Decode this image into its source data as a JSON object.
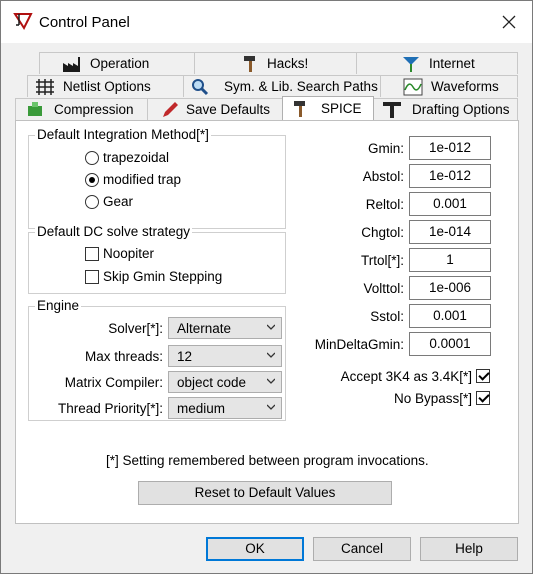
{
  "window": {
    "title": "Control Panel"
  },
  "tabs": {
    "row1": [
      {
        "label": "Operation",
        "icon": "factory-icon"
      },
      {
        "label": "Hacks!",
        "icon": "hammer-icon"
      },
      {
        "label": "Internet",
        "icon": "antenna-icon"
      }
    ],
    "row2": [
      {
        "label": "Netlist Options",
        "icon": "grid-icon"
      },
      {
        "label": "Sym. & Lib. Search Paths",
        "icon": "magnifier-icon"
      },
      {
        "label": "Waveforms",
        "icon": "waveform-icon"
      }
    ],
    "row3": [
      {
        "label": "Compression",
        "icon": "compress-icon"
      },
      {
        "label": "Save Defaults",
        "icon": "pen-icon"
      },
      {
        "label": "SPICE",
        "icon": "hammer-icon",
        "active": true
      },
      {
        "label": "Drafting Options",
        "icon": "t-square-icon"
      }
    ]
  },
  "integration": {
    "title": "Default Integration Method[*]",
    "options": [
      "trapezoidal",
      "modified trap",
      "Gear"
    ],
    "selected": "modified trap"
  },
  "dc_strategy": {
    "title": "Default DC solve strategy",
    "options": [
      {
        "label": "Noopiter",
        "checked": false
      },
      {
        "label": "Skip Gmin Stepping",
        "checked": false
      }
    ]
  },
  "engine": {
    "title": "Engine",
    "solver": {
      "label": "Solver[*]:",
      "value": "Alternate"
    },
    "threads": {
      "label": "Max threads:",
      "value": "12"
    },
    "compiler": {
      "label": "Matrix Compiler:",
      "value": "object code"
    },
    "priority": {
      "label": "Thread Priority[*]:",
      "value": "medium"
    }
  },
  "params": [
    {
      "label": "Gmin:",
      "value": "1e-012"
    },
    {
      "label": "Abstol:",
      "value": "1e-012"
    },
    {
      "label": "Reltol:",
      "value": "0.001"
    },
    {
      "label": "Chgtol:",
      "value": "1e-014"
    },
    {
      "label": "Trtol[*]:",
      "value": "1"
    },
    {
      "label": "Volttol:",
      "value": "1e-006"
    },
    {
      "label": "Sstol:",
      "value": "0.001"
    },
    {
      "label": "MinDeltaGmin:",
      "value": "0.0001"
    }
  ],
  "flags": [
    {
      "label": "Accept 3K4 as 3.4K[*]",
      "checked": true
    },
    {
      "label": "No Bypass[*]",
      "checked": true
    }
  ],
  "note": "[*] Setting remembered between program invocations.",
  "reset_label": "Reset to Default Values",
  "buttons": {
    "ok": "OK",
    "cancel": "Cancel",
    "help": "Help"
  }
}
